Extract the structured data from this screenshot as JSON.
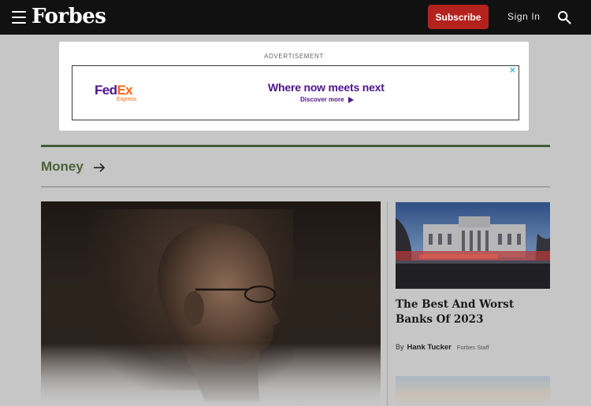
{
  "header": {
    "logo": "Forbes",
    "subscribe_label": "Subscribe",
    "signin_label": "Sign In",
    "menu_icon": "hamburger-menu-icon",
    "search_icon": "search-icon"
  },
  "advertisement": {
    "label": "ADVERTISEMENT",
    "brand_part1": "Fed",
    "brand_part2": "Ex",
    "brand_sub": "Express",
    "headline": "Where now meets next",
    "cta": "Discover more",
    "close_icon": "ad-choices-close-icon",
    "colors": {
      "purple": "#4d148c",
      "orange": "#ff6200"
    }
  },
  "section": {
    "title": "Money",
    "arrow_icon": "arrow-right-icon",
    "accent_color": "#445b34"
  },
  "side_story": {
    "title": "The Best And Worst Banks Of 2023",
    "byline_prefix": "By",
    "author": "Hank Tucker",
    "author_role": "Forbes Staff"
  },
  "colors": {
    "header_bg": "#111111",
    "subscribe_bg": "#b3221d",
    "page_bg": "#c6c6c6"
  }
}
